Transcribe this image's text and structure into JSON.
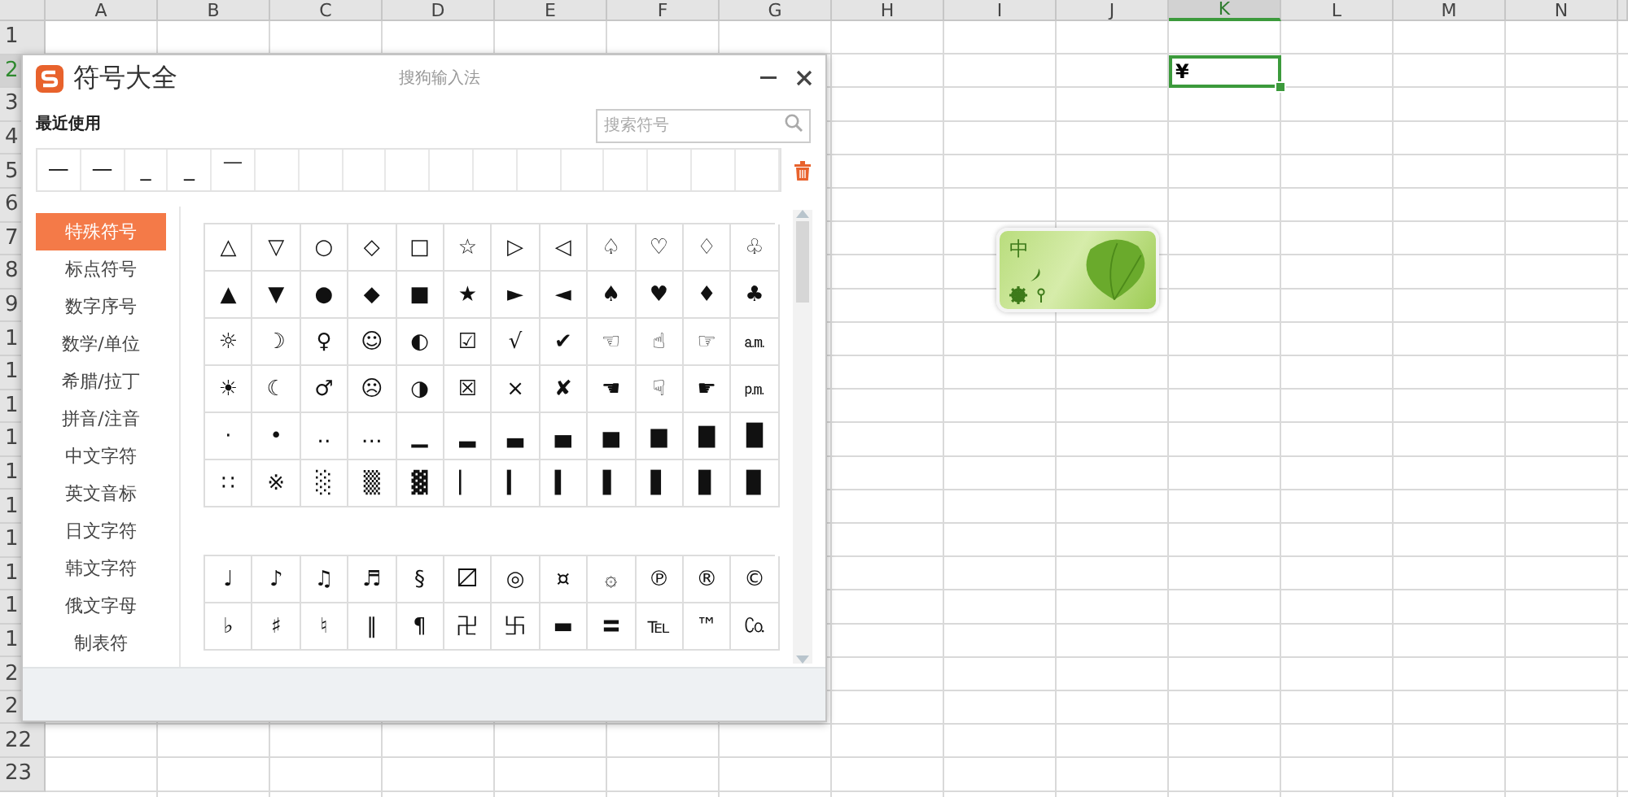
{
  "sheet": {
    "columns": [
      {
        "label": "A",
        "selected": false
      },
      {
        "label": "B",
        "selected": false
      },
      {
        "label": "C",
        "selected": false
      },
      {
        "label": "D",
        "selected": false
      },
      {
        "label": "E",
        "selected": false
      },
      {
        "label": "F",
        "selected": false
      },
      {
        "label": "G",
        "selected": false
      },
      {
        "label": "H",
        "selected": false
      },
      {
        "label": "I",
        "selected": false
      },
      {
        "label": "J",
        "selected": false
      },
      {
        "label": "K",
        "selected": true
      },
      {
        "label": "L",
        "selected": false
      },
      {
        "label": "M",
        "selected": false
      },
      {
        "label": "N",
        "selected": false
      }
    ],
    "rows": [
      {
        "label": "1",
        "selected": false
      },
      {
        "label": "2",
        "selected": true
      },
      {
        "label": "3",
        "selected": false
      },
      {
        "label": "4",
        "selected": false
      },
      {
        "label": "5",
        "selected": false
      },
      {
        "label": "6",
        "selected": false
      },
      {
        "label": "7",
        "selected": false
      },
      {
        "label": "8",
        "selected": false
      },
      {
        "label": "9",
        "selected": false
      },
      {
        "label": "1",
        "selected": false
      },
      {
        "label": "1",
        "selected": false
      },
      {
        "label": "1",
        "selected": false
      },
      {
        "label": "1",
        "selected": false
      },
      {
        "label": "1",
        "selected": false
      },
      {
        "label": "1",
        "selected": false
      },
      {
        "label": "1",
        "selected": false
      },
      {
        "label": "1",
        "selected": false
      },
      {
        "label": "1",
        "selected": false
      },
      {
        "label": "1",
        "selected": false
      },
      {
        "label": "2",
        "selected": false
      },
      {
        "label": "2",
        "selected": false
      },
      {
        "label": "22",
        "selected": false
      },
      {
        "label": "23",
        "selected": false
      }
    ],
    "active_cell": {
      "value": "¥"
    }
  },
  "dialog": {
    "title": "符号大全",
    "app_name": "搜狗输入法",
    "recent_label": "最近使用",
    "search": {
      "placeholder": "搜索符号"
    },
    "recent": [
      "—",
      "—",
      "_",
      "_",
      "￣"
    ],
    "categories": [
      {
        "label": "特殊符号",
        "selected": true
      },
      {
        "label": "标点符号",
        "selected": false
      },
      {
        "label": "数字序号",
        "selected": false
      },
      {
        "label": "数学/单位",
        "selected": false
      },
      {
        "label": "希腊/拉丁",
        "selected": false
      },
      {
        "label": "拼音/注音",
        "selected": false
      },
      {
        "label": "中文字符",
        "selected": false
      },
      {
        "label": "英文音标",
        "selected": false
      },
      {
        "label": "日文字符",
        "selected": false
      },
      {
        "label": "韩文字符",
        "selected": false
      },
      {
        "label": "俄文字母",
        "selected": false
      },
      {
        "label": "制表符",
        "selected": false
      }
    ],
    "sections": [
      {
        "symbols": [
          "△",
          "▽",
          "○",
          "◇",
          "□",
          "☆",
          "▷",
          "◁",
          "♤",
          "♡",
          "♢",
          "♧",
          "▲",
          "▼",
          "●",
          "◆",
          "■",
          "★",
          "►",
          "◄",
          "♠",
          "♥",
          "♦",
          "♣",
          "☼",
          "☽",
          "♀",
          "☺",
          "◐",
          "☑",
          "√",
          "✔",
          "☜",
          "☝",
          "☞",
          "㏂",
          "☀",
          "☾",
          "♂",
          "☹",
          "◑",
          "☒",
          "×",
          "✘",
          "☚",
          "☟",
          "☛",
          "㏘",
          "·",
          "•",
          "‥",
          "…",
          "▁",
          "▂",
          "▃",
          "▄",
          "▅",
          "▆",
          "▇",
          "█",
          "∷",
          "※",
          "░",
          "▒",
          "▓",
          "▏",
          "▎",
          "▍",
          "▌",
          "▋",
          "▊",
          "▉"
        ]
      },
      {
        "symbols": [
          "♩",
          "♪",
          "♫",
          "♬",
          "§",
          "〼",
          "◎",
          "¤",
          "۞",
          "℗",
          "®",
          "©",
          "♭",
          "♯",
          "♮",
          "‖",
          "¶",
          "卍",
          "卐",
          "▬",
          "〓",
          "℡",
          "™",
          "㏇"
        ]
      }
    ]
  },
  "ime_toolbar": {
    "mode": "中"
  }
}
